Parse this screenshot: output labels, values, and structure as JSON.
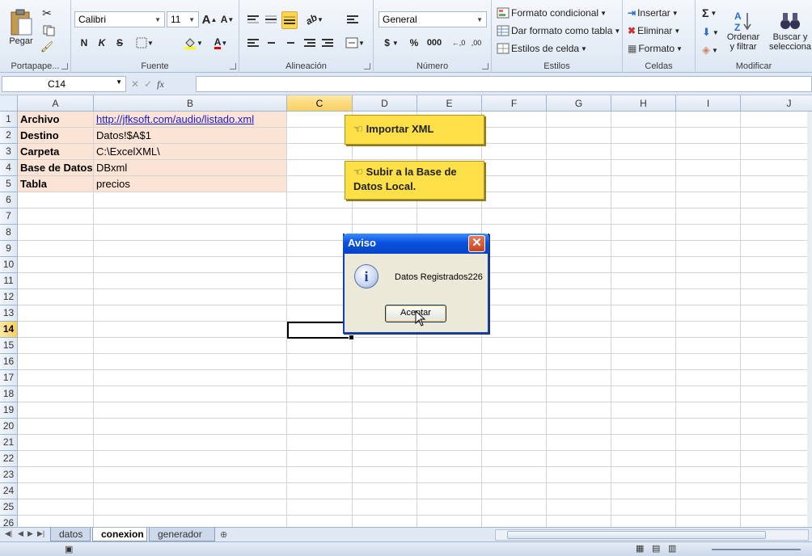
{
  "ribbon": {
    "clipboard": {
      "paste_label": "Pegar",
      "group_label": "Portapape..."
    },
    "font": {
      "name": "Calibri",
      "size": "11",
      "group_label": "Fuente",
      "grow": "A",
      "shrink": "A",
      "bold": "N",
      "italic": "K",
      "strike": "S"
    },
    "alignment": {
      "group_label": "Alineación"
    },
    "number": {
      "format": "General",
      "currency": "$",
      "percent": "%",
      "thousands": "000",
      "group_label": "Número"
    },
    "styles": {
      "conditional": "Formato condicional",
      "table": "Dar formato como tabla",
      "cell_styles": "Estilos de celda",
      "group_label": "Estilos"
    },
    "cells": {
      "insert": "Insertar",
      "delete": "Eliminar",
      "format": "Formato",
      "group_label": "Celdas"
    },
    "modify": {
      "sum": "Σ",
      "sort_line1": "Ordenar",
      "sort_line2": "y filtrar",
      "find_line1": "Buscar y",
      "find_line2": "selecciona",
      "group_label": "Modificar"
    }
  },
  "formula_bar": {
    "name_box": "C14",
    "fx": "fx",
    "value": ""
  },
  "grid": {
    "columns": [
      "A",
      "B",
      "C",
      "D",
      "E",
      "F",
      "G",
      "H",
      "I",
      "J"
    ],
    "active_column": "C",
    "rows": [
      "1",
      "2",
      "3",
      "4",
      "5",
      "6",
      "7",
      "8",
      "9",
      "10",
      "11",
      "12",
      "13",
      "14",
      "15",
      "16",
      "17",
      "18",
      "19",
      "20",
      "21",
      "22",
      "23",
      "24",
      "25",
      "26"
    ],
    "active_row": "14",
    "data": [
      {
        "label": "Archivo",
        "value": "http://jfksoft.com/audio/listado.xml"
      },
      {
        "label": "Destino",
        "value": "Datos!$A$1"
      },
      {
        "label": "Carpeta",
        "value": "C:\\ExcelXML\\"
      },
      {
        "label": "Base de Datos",
        "value": "DBxml"
      },
      {
        "label": "Tabla",
        "value": "precios"
      }
    ]
  },
  "buttons": {
    "import_xml": "Importar XML",
    "upload_line1": "Subir a la Base de",
    "upload_line2": "Datos Local."
  },
  "dialog": {
    "title": "Aviso",
    "close": "✕",
    "icon": "i",
    "message": "Datos Registrados226",
    "ok": "Aceptar"
  },
  "sheets": {
    "tabs": [
      "datos",
      "conexion",
      "generador"
    ],
    "active": "conexion"
  }
}
